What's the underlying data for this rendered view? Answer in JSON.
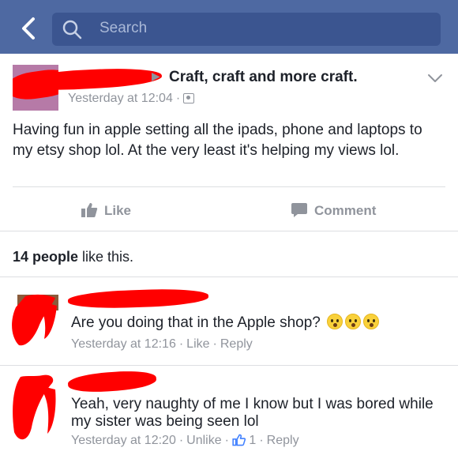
{
  "search": {
    "placeholder": "Search"
  },
  "post": {
    "group": "Craft, craft and more craft.",
    "timestamp": "Yesterday at 12:04",
    "meta_sep": "·",
    "body": "Having fun in apple setting all the ipads, phone and laptops to my etsy shop lol. At the very least it's helping my views lol.",
    "actions": {
      "like": "Like",
      "comment": "Comment"
    }
  },
  "likes": {
    "count": "14 people",
    "suffix": " like this."
  },
  "comments": [
    {
      "text": "Are you doing that in the Apple shop?",
      "emoji": [
        "hushed-face",
        "hushed-face",
        "hushed-face"
      ],
      "time": "Yesterday at 12:16",
      "action": "Like",
      "reply": "Reply"
    },
    {
      "text": "Yeah, very naughty of me I know but I was bored while my sister was being seen lol",
      "time": "Yesterday at 12:20",
      "action": "Unlike",
      "like_count": "1",
      "reply": "Reply"
    }
  ],
  "colors": {
    "header": "#4e69a2",
    "search_box": "#3b5590",
    "meta_gray": "#90949c",
    "like_blue": "#4080ff",
    "redaction": "#ff0000"
  }
}
